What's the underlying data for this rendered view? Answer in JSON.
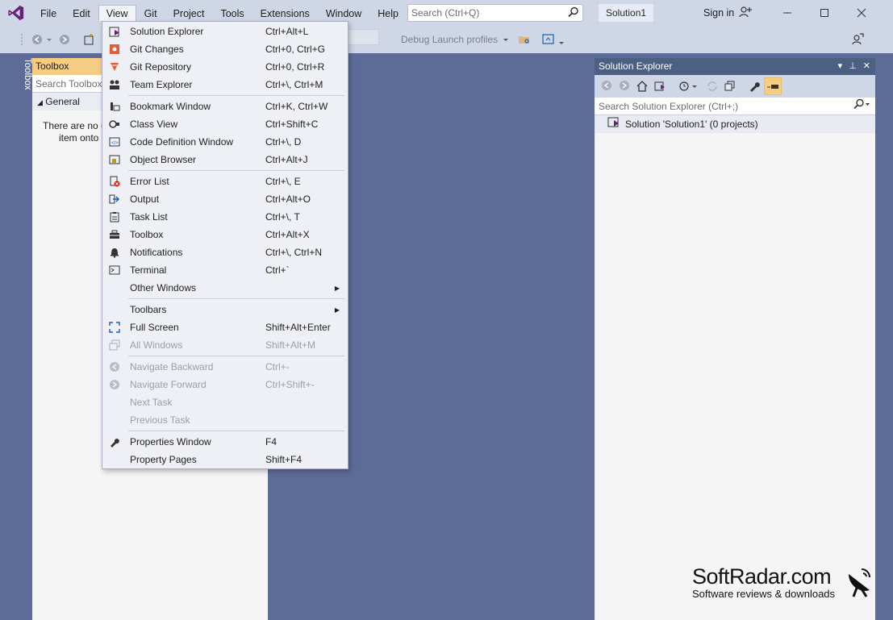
{
  "menubar": {
    "items": [
      "File",
      "Edit",
      "View",
      "Git",
      "Project",
      "Tools",
      "Extensions",
      "Window",
      "Help"
    ],
    "active": "View"
  },
  "search": {
    "placeholder": "Search (Ctrl+Q)"
  },
  "solution_name": "Solution1",
  "signin_label": "Sign in",
  "toolbar": {
    "debug_profiles": "Debug Launch profiles"
  },
  "side_tab": "Toolbox",
  "toolbox": {
    "title": "Toolbox",
    "search_placeholder": "Search Toolbox",
    "group": "General",
    "empty_line1": "There are no u",
    "empty_line2": "item onto"
  },
  "solution_explorer": {
    "title": "Solution Explorer",
    "search_placeholder": "Search Solution Explorer (Ctrl+;)",
    "solution_row": "Solution 'Solution1' (0 projects)"
  },
  "view_menu": {
    "items": [
      {
        "label": "Solution Explorer",
        "shortcut": "Ctrl+Alt+L",
        "icon": "solution-explorer-icon"
      },
      {
        "label": "Git Changes",
        "shortcut": "Ctrl+0, Ctrl+G",
        "icon": "git-changes-icon"
      },
      {
        "label": "Git Repository",
        "shortcut": "Ctrl+0, Ctrl+R",
        "icon": "git-repository-icon"
      },
      {
        "label": "Team Explorer",
        "shortcut": "Ctrl+\\, Ctrl+M",
        "icon": "team-explorer-icon"
      },
      {
        "label": "Bookmark Window",
        "shortcut": "Ctrl+K, Ctrl+W",
        "icon": "bookmark-icon"
      },
      {
        "label": "Class View",
        "shortcut": "Ctrl+Shift+C",
        "icon": "class-view-icon"
      },
      {
        "label": "Code Definition Window",
        "shortcut": "Ctrl+\\, D",
        "icon": "code-definition-icon"
      },
      {
        "label": "Object Browser",
        "shortcut": "Ctrl+Alt+J",
        "icon": "object-browser-icon"
      },
      {
        "label": "Error List",
        "shortcut": "Ctrl+\\, E",
        "icon": "error-list-icon"
      },
      {
        "label": "Output",
        "shortcut": "Ctrl+Alt+O",
        "icon": "output-icon"
      },
      {
        "label": "Task List",
        "shortcut": "Ctrl+\\, T",
        "icon": "task-list-icon"
      },
      {
        "label": "Toolbox",
        "shortcut": "Ctrl+Alt+X",
        "icon": "toolbox-icon"
      },
      {
        "label": "Notifications",
        "shortcut": "Ctrl+\\, Ctrl+N",
        "icon": "bell-icon"
      },
      {
        "label": "Terminal",
        "shortcut": "Ctrl+`",
        "icon": "terminal-icon"
      },
      {
        "label": "Other Windows",
        "shortcut": "",
        "icon": "",
        "submenu": true
      },
      {
        "label": "Toolbars",
        "shortcut": "",
        "icon": "",
        "submenu": true
      },
      {
        "label": "Full Screen",
        "shortcut": "Shift+Alt+Enter",
        "icon": "full-screen-icon"
      },
      {
        "label": "All Windows",
        "shortcut": "Shift+Alt+M",
        "icon": "all-windows-icon",
        "disabled": true
      },
      {
        "label": "Navigate Backward",
        "shortcut": "Ctrl+-",
        "icon": "back-icon",
        "disabled": true
      },
      {
        "label": "Navigate Forward",
        "shortcut": "Ctrl+Shift+-",
        "icon": "forward-icon",
        "disabled": true
      },
      {
        "label": "Next Task",
        "shortcut": "",
        "icon": "",
        "disabled": true
      },
      {
        "label": "Previous Task",
        "shortcut": "",
        "icon": "",
        "disabled": true
      },
      {
        "label": "Properties Window",
        "shortcut": "F4",
        "icon": "wrench-icon"
      },
      {
        "label": "Property Pages",
        "shortcut": "Shift+F4",
        "icon": ""
      }
    ]
  },
  "watermark": {
    "brand": "SoftRadar.com",
    "tagline": "Software reviews & downloads"
  },
  "colors": {
    "accent_purple": "#68217a",
    "chrome": "#cfd6e5",
    "workspace": "#5d6b99",
    "panel_header": "#4d6082",
    "toolbox_header": "#f5cc84"
  }
}
